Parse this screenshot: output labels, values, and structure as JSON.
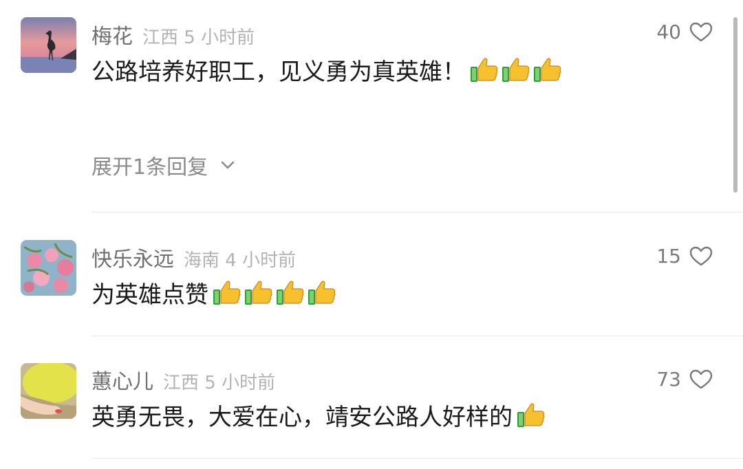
{
  "comments": [
    {
      "username": "梅花",
      "meta": "江西 5 小时前",
      "text": "公路培养好职工，见义勇为真英雄！",
      "thumbs": 3,
      "likes": "40",
      "replies_label": "展开1条回复"
    },
    {
      "username": "快乐永远",
      "meta": "海南 4 小时前",
      "text": "为英雄点赞",
      "thumbs": 4,
      "likes": "15"
    },
    {
      "username": "蕙心儿",
      "meta": "江西 5 小时前",
      "text": "英勇无畏，大爱在心，靖安公路人好样的",
      "thumbs": 1,
      "likes": "73"
    }
  ],
  "icons": {
    "like": "heart-outline-icon",
    "reaction": "thumbs-up-emoji",
    "expand": "chevron-down-icon"
  },
  "colors": {
    "username": "#707070",
    "meta": "#b3b3b3",
    "text": "#1a1a1a",
    "like_count": "#7a7a7a",
    "thumb_yellow": "#f6c02e",
    "cuff_green": "#2e9b3e"
  }
}
